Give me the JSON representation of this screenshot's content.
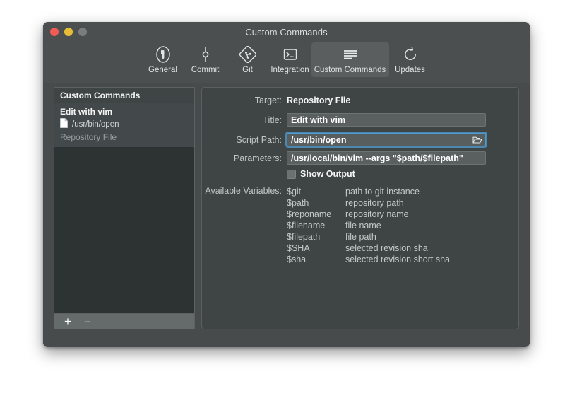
{
  "window": {
    "title": "Custom Commands",
    "traffic_lights": [
      "close",
      "minimize",
      "zoom"
    ]
  },
  "toolbar": {
    "items": [
      {
        "label": "General",
        "icon": "general-icon",
        "selected": false
      },
      {
        "label": "Commit",
        "icon": "commit-icon",
        "selected": false
      },
      {
        "label": "Git",
        "icon": "git-icon",
        "selected": false
      },
      {
        "label": "Integration",
        "icon": "integration-icon",
        "selected": false
      },
      {
        "label": "Custom Commands",
        "icon": "custom-commands-icon",
        "selected": true
      },
      {
        "label": "Updates",
        "icon": "updates-icon",
        "selected": false
      }
    ]
  },
  "sidebar": {
    "header": "Custom Commands",
    "items": [
      {
        "title": "Edit with vim",
        "path": "/usr/bin/open",
        "target": "Repository File",
        "icon": "document-icon",
        "selected": true
      }
    ],
    "footer": {
      "add_label": "+",
      "remove_label": "–"
    }
  },
  "detail": {
    "target_label": "Target:",
    "target_value": "Repository File",
    "title_label": "Title:",
    "title_value": "Edit with vim",
    "script_path_label": "Script Path:",
    "script_path_value": "/usr/bin/open",
    "script_path_browse_icon": "open-folder-icon",
    "parameters_label": "Parameters:",
    "parameters_value": "/usr/local/bin/vim --args \"$path/$filepath\"",
    "show_output_label": "Show Output",
    "show_output_checked": false,
    "available_variables_label": "Available Variables:",
    "variables": [
      {
        "name": "$git",
        "desc": "path to git instance"
      },
      {
        "name": "$path",
        "desc": "repository path"
      },
      {
        "name": "$reponame",
        "desc": "repository name"
      },
      {
        "name": "$filename",
        "desc": "file name"
      },
      {
        "name": "$filepath",
        "desc": "file path"
      },
      {
        "name": "$SHA",
        "desc": "selected revision sha"
      },
      {
        "name": "$sha",
        "desc": "selected revision short sha"
      }
    ]
  },
  "colors": {
    "window_bg": "#4b4f50",
    "content_bg": "#474b4c",
    "panel_bg": "#3f4444",
    "list_bg": "#2d3232",
    "focus_ring": "#4b9ad4",
    "traffic_close": "#f05b55",
    "traffic_min": "#e7bd36",
    "traffic_zoom": "#797d7d"
  }
}
